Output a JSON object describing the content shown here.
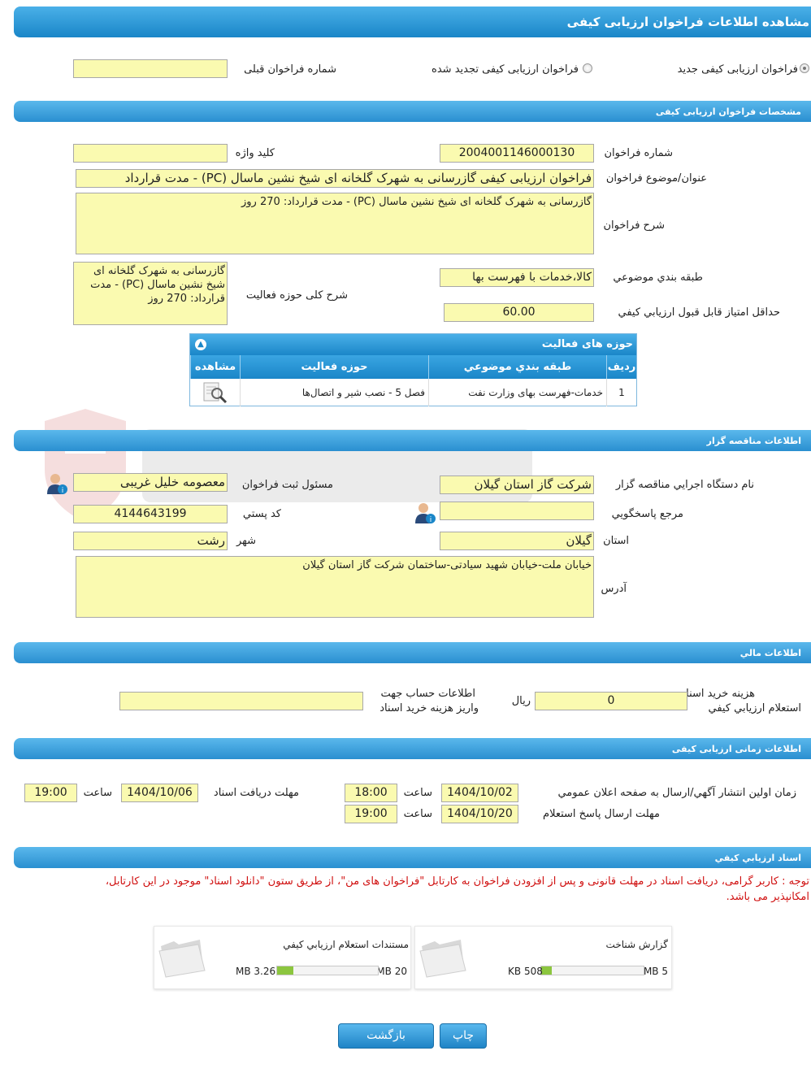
{
  "header": {
    "title": "مشاهده اطلاعات فراخوان ارزیابی کیفی"
  },
  "options": {
    "new_label": "فراخوان ارزیابی کیفی جدید",
    "renewed_label": "فراخوان ارزیابی کیفی تجدید شده",
    "prev_number_label": "شماره فراخوان قبلی",
    "prev_number_value": ""
  },
  "spec": {
    "section_title": "مشخصات فراخوان ارزیابی کیفی",
    "number_label": "شماره فراخوان",
    "number_value": "2004001146000130",
    "keyword_label": "کلید واژه",
    "keyword_value": "",
    "subject_label": "عنوان/موضوع فراخوان",
    "subject_value": "فراخوان ارزیابی کیفی گازرسانی به شهرک گلخانه ای شیخ نشین ماسال (PC) - مدت قرارداد",
    "desc_label": "شرح فراخوان",
    "desc_value": "گازرسانی به شهرک گلخانه ای شیخ نشین ماسال (PC) - مدت قرارداد: 270 روز",
    "category_label": "طبقه بندي موضوعي",
    "category_value": "کالا،خدمات با فهرست بها",
    "activity_desc_label": "شرح کلی حوزه فعالیت",
    "activity_desc_value": "گازرسانی به شهرک گلخانه ای شیخ نشین ماسال (PC) - مدت قرارداد: 270 روز",
    "min_score_label": "حداقل امتياز قابل قبول ارزيابي کيفي",
    "min_score_value": "60.00"
  },
  "activities": {
    "title": "حوزه های فعالیت",
    "headers": {
      "row": "رديف",
      "category": "طبقه بندي موضوعي",
      "field": "حوزه فعاليت",
      "view": "مشاهده"
    },
    "rows": [
      {
        "row": "1",
        "category": "خدمات-فهرست بهای وزارت نفت",
        "field": "فصل 5 - نصب شیر و اتصال‌ها"
      }
    ]
  },
  "organizer": {
    "section_title": "اطلاعات مناقصه گزار",
    "org_label": "نام دستگاه اجرايي مناقصه گزار",
    "org_value": "شرکت گاز استان گیلان",
    "registrar_label": "مسئول ثبت فراخوان",
    "registrar_value": "معصومه خلیل غریبی",
    "ref_label": "مرجع پاسخگويي",
    "ref_value": "",
    "postal_label": "کد پستي",
    "postal_value": "4144643199",
    "province_label": "استان",
    "province_value": "گیلان",
    "city_label": "شهر",
    "city_value": "رشت",
    "address_label": "آدرس",
    "address_value": "خیابان ملت-خیابان شهید سیادتی-ساختمان شرکت گاز استان گیلان"
  },
  "finance": {
    "section_title": "اطلاعات مالي",
    "cost_label_1": "هزينه خريد اسناد",
    "cost_label_2": "استعلام ارزيابي کيفي",
    "cost_value": "0",
    "currency": "ريال",
    "account_label_1": "اطلاعات حساب جهت",
    "account_label_2": "واريز هزينه خريد اسناد",
    "account_value": ""
  },
  "timing": {
    "section_title": "اطلاعات زمانی ارزیابی کیفی",
    "publish_label": "زمان اولين انتشار آگهي/ارسال به صفحه اعلان عمومي",
    "publish_date": "1404/10/02",
    "publish_time": "18:00",
    "receive_label": "مهلت دريافت اسناد",
    "receive_date": "1404/10/06",
    "receive_time": "19:00",
    "reply_label": "مهلت ارسال پاسخ استعلام",
    "reply_date": "1404/10/20",
    "reply_time": "19:00",
    "time_label": "ساعت"
  },
  "documents": {
    "section_title": "اسناد ارزيابي کيفي",
    "note_line_1": "توجه : کاربر گرامی، دریافت اسناد در مهلت قانونی و پس از افزودن فراخوان به کارتابل \"فراخوان های من\"، از طریق ستون \"دانلود اسناد\" موجود در این کارتابل،",
    "note_line_2": "امکانپذیر می باشد.",
    "files": [
      {
        "name": "گزارش شناخت",
        "size": "508 KB",
        "max": "5 MB",
        "fill": 0.1
      },
      {
        "name": "مستندات استعلام ارزيابي کيفي",
        "size": "3.26 MB",
        "max": "20 MB",
        "fill": 0.16
      }
    ]
  },
  "buttons": {
    "print": "چاپ",
    "back": "بازگشت"
  },
  "colors": {
    "header_blue": "#1a86c8",
    "field_yellow": "#fafab0",
    "note_red": "#d01010",
    "progress_green": "#8cc63f"
  }
}
